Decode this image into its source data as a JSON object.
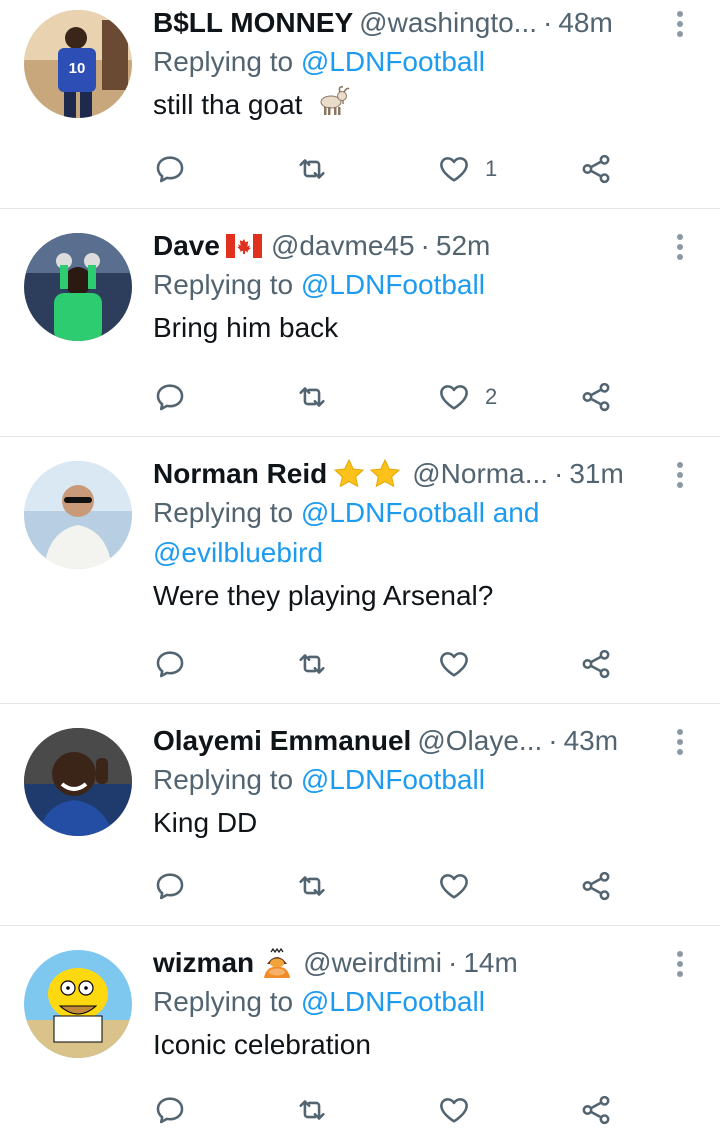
{
  "replies": [
    {
      "name": "B$LL MONNEY",
      "handle": "@washingto...",
      "time": "48m",
      "replying_label": "Replying to",
      "mentions": "@LDNFootball",
      "mentions2": "",
      "text": "still tha goat",
      "emoji_icon": "goat-icon",
      "like_count": "1"
    },
    {
      "name": "Dave",
      "name_badge": "canada-flag-icon",
      "handle": "@davme45",
      "time": "52m",
      "replying_label": "Replying to",
      "mentions": "@LDNFootball",
      "mentions2": "",
      "text": "Bring him back",
      "like_count": "2"
    },
    {
      "name": "Norman Reid",
      "name_badge": "two-stars-icon",
      "handle": "@Norma...",
      "time": "31m",
      "replying_label": "Replying to",
      "mentions": "@LDNFootball and",
      "mentions2": "@evilbluebird",
      "text": "Were they playing Arsenal?",
      "like_count": ""
    },
    {
      "name": "Olayemi Emmanuel",
      "handle": "@Olaye...",
      "time": "43m",
      "replying_label": "Replying to",
      "mentions": "@LDNFootball",
      "mentions2": "",
      "text": "King DD",
      "like_count": ""
    },
    {
      "name": "wizman",
      "name_badge": "person-bowing-icon",
      "handle": "@weirdtimi",
      "time": "14m",
      "replying_label": "Replying to",
      "mentions": "@LDNFootball",
      "mentions2": "",
      "text": "Iconic celebration",
      "like_count": ""
    }
  ],
  "colors": {
    "link": "#1d9bf0",
    "secondary_text": "#536471",
    "primary_text": "#0f1419",
    "divider": "#e1e6ea"
  }
}
